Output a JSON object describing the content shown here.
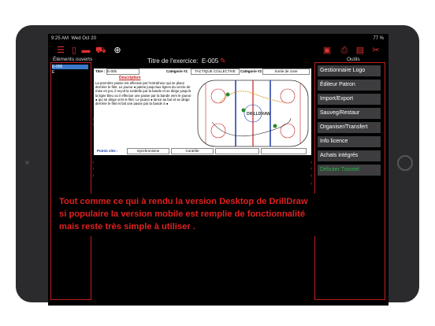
{
  "status": {
    "time": "9:25 AM",
    "date": "Wed Oct 20",
    "battery": "77 %"
  },
  "toolbar": {
    "left_icons": [
      "list-icon",
      "new-file-icon",
      "folder-icon",
      "cart-icon",
      "globe-icon"
    ],
    "right_icons": [
      "pdf-icon",
      "print-icon",
      "save-icon",
      "tools-icon"
    ]
  },
  "left": {
    "title": "Éléments ouverts",
    "items": [
      "E-005",
      "E"
    ]
  },
  "exercise": {
    "title_label": "Titre de l'exercice:",
    "title_value": "E-005"
  },
  "doc": {
    "titre_label": "Titre :",
    "titre_value": "E-005",
    "cat1_label": "Catégorie #1",
    "cat1_value": "TACTIQUE COLLECTIVE",
    "cat2_label": "Catégorie #2",
    "cat2_value": "Sortie de zone",
    "desc_title": "Description",
    "desc_text": "La première passe est effectué par l'entraîneur qui se place derrière le filet. Le joueur ● patine jusqu'aux lignes du cercle de mise en jeu, il reçoit la rondelle par la bande et se dirige jusqu'à la ligne bleu ou il effectue une passe par la bande vers le joueur ● qui se dirige vers le filet. Le joueur ● lance au but et se dirige derrière le filet et fait une passe par la bande à ●",
    "rink_label": "DRILLDRAW",
    "points_label": "Points clés :",
    "points": [
      "Synchronisme",
      "Contrôle",
      "",
      ""
    ]
  },
  "right": {
    "title": "Outils",
    "buttons": [
      "Gestionnaire Logo",
      "Éditeur Patron",
      "Import/Export",
      "Sauveg/Restaur",
      "Organiser/Transfert",
      "Info licence",
      "Achats intégrés",
      "Débuter Tutoriel"
    ]
  },
  "overlay": {
    "line1": "Tout comme ce qui à rendu la version Desktop de DrillDraw",
    "line2": "si populaire la version mobile est remplie de fonctionnalité",
    "line3": "mais reste très simple à utiliser ."
  }
}
